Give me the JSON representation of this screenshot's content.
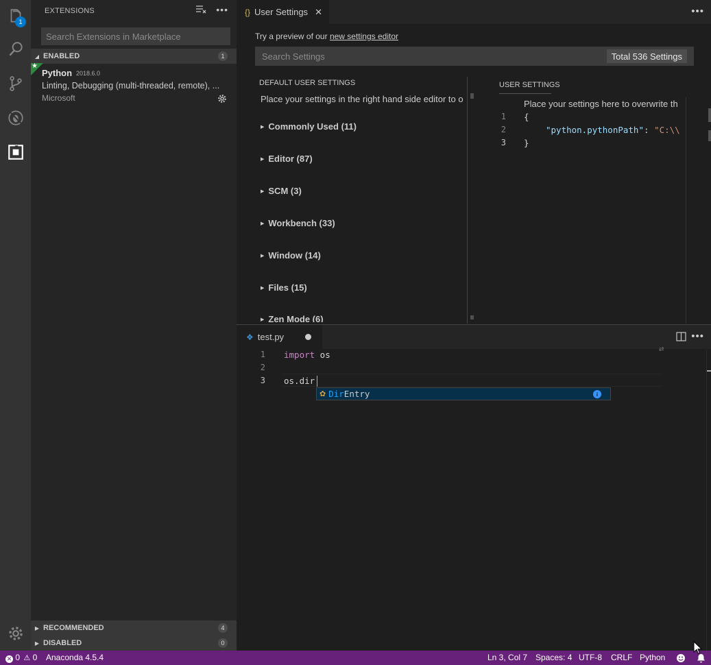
{
  "activity": {
    "explorer_badge": "1"
  },
  "sidebar": {
    "title": "EXTENSIONS",
    "search_placeholder": "Search Extensions in Marketplace",
    "sections": {
      "enabled": {
        "label": "ENABLED",
        "count": "1"
      },
      "recommended": {
        "label": "RECOMMENDED",
        "count": "4"
      },
      "disabled": {
        "label": "DISABLED",
        "count": "0"
      }
    },
    "extension": {
      "name": "Python",
      "version": "2018.6.0",
      "description": "Linting, Debugging (multi-threaded, remote), ...",
      "publisher": "Microsoft"
    }
  },
  "top_editor": {
    "tab_label": "User Settings",
    "tab_icon": "{}",
    "preview_text": "Try a preview of our ",
    "preview_link": "new settings editor",
    "search_placeholder": "Search Settings",
    "total_settings": "Total 536 Settings",
    "default_pane": {
      "title": "DEFAULT USER SETTINGS",
      "subtitle": "Place your settings in the right hand side editor to o",
      "categories": [
        "Commonly Used (11)",
        "Editor (87)",
        "SCM (3)",
        "Workbench (33)",
        "Window (14)",
        "Files (15)",
        "Zen Mode (6)"
      ]
    },
    "user_pane": {
      "title": "USER SETTINGS",
      "subtitle": "Place your settings here to overwrite th",
      "lines": [
        {
          "num": "1",
          "text": "{"
        },
        {
          "num": "2",
          "key": "\"python.pythonPath\"",
          "sep": ": ",
          "value": "\"C:\\\\"
        },
        {
          "num": "3",
          "text": "}"
        }
      ]
    }
  },
  "bottom_editor": {
    "tab_label": "test.py",
    "lines": [
      {
        "num": "1",
        "kw": "import",
        "rest": " os"
      },
      {
        "num": "2",
        "text": ""
      },
      {
        "num": "3",
        "text": "os.dir"
      }
    ],
    "suggestion": {
      "match": "Dir",
      "rest": "Entry",
      "info": "i"
    }
  },
  "status_bar": {
    "errors": "0",
    "warnings": "0",
    "interpreter": "Anaconda 4.5.4",
    "position": "Ln 3, Col 7",
    "spaces": "Spaces: 4",
    "encoding": "UTF-8",
    "eol": "CRLF",
    "language": "Python"
  },
  "colors": {
    "status_bar": "#68217a",
    "accent": "#007acc"
  }
}
